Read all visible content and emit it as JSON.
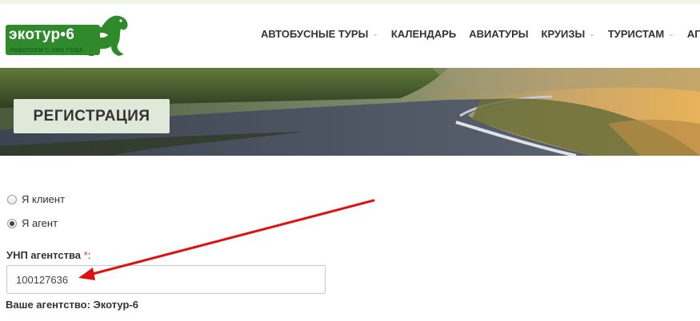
{
  "logo": {
    "brand": "экотур•6",
    "tagline": "РАБОТАЕМ С 1991 ГОДА"
  },
  "nav": [
    {
      "label": "АВТОБУСНЫЕ ТУРЫ",
      "dropdown": true
    },
    {
      "label": "КАЛЕНДАРЬ",
      "dropdown": false
    },
    {
      "label": "АВИАТУРЫ",
      "dropdown": false
    },
    {
      "label": "КРУИЗЫ",
      "dropdown": true
    },
    {
      "label": "ТУРИСТАМ",
      "dropdown": true
    },
    {
      "label": "АГЕНТА",
      "dropdown": false
    }
  ],
  "banner": {
    "title": "РЕГИСТРАЦИЯ"
  },
  "form": {
    "radio_client": "Я клиент",
    "radio_agent": "Я агент",
    "selected": "agent",
    "unp_label": "УНП агентства",
    "unp_required": "*",
    "unp_colon": ":",
    "unp_value": "100127636",
    "agency_text": "Ваше агентство: Экотур-6"
  },
  "colors": {
    "brand_green": "#2f8a2c",
    "title_box": "#dfe8d9",
    "annotation_arrow": "#e01010",
    "required_mark": "#dd3333"
  }
}
